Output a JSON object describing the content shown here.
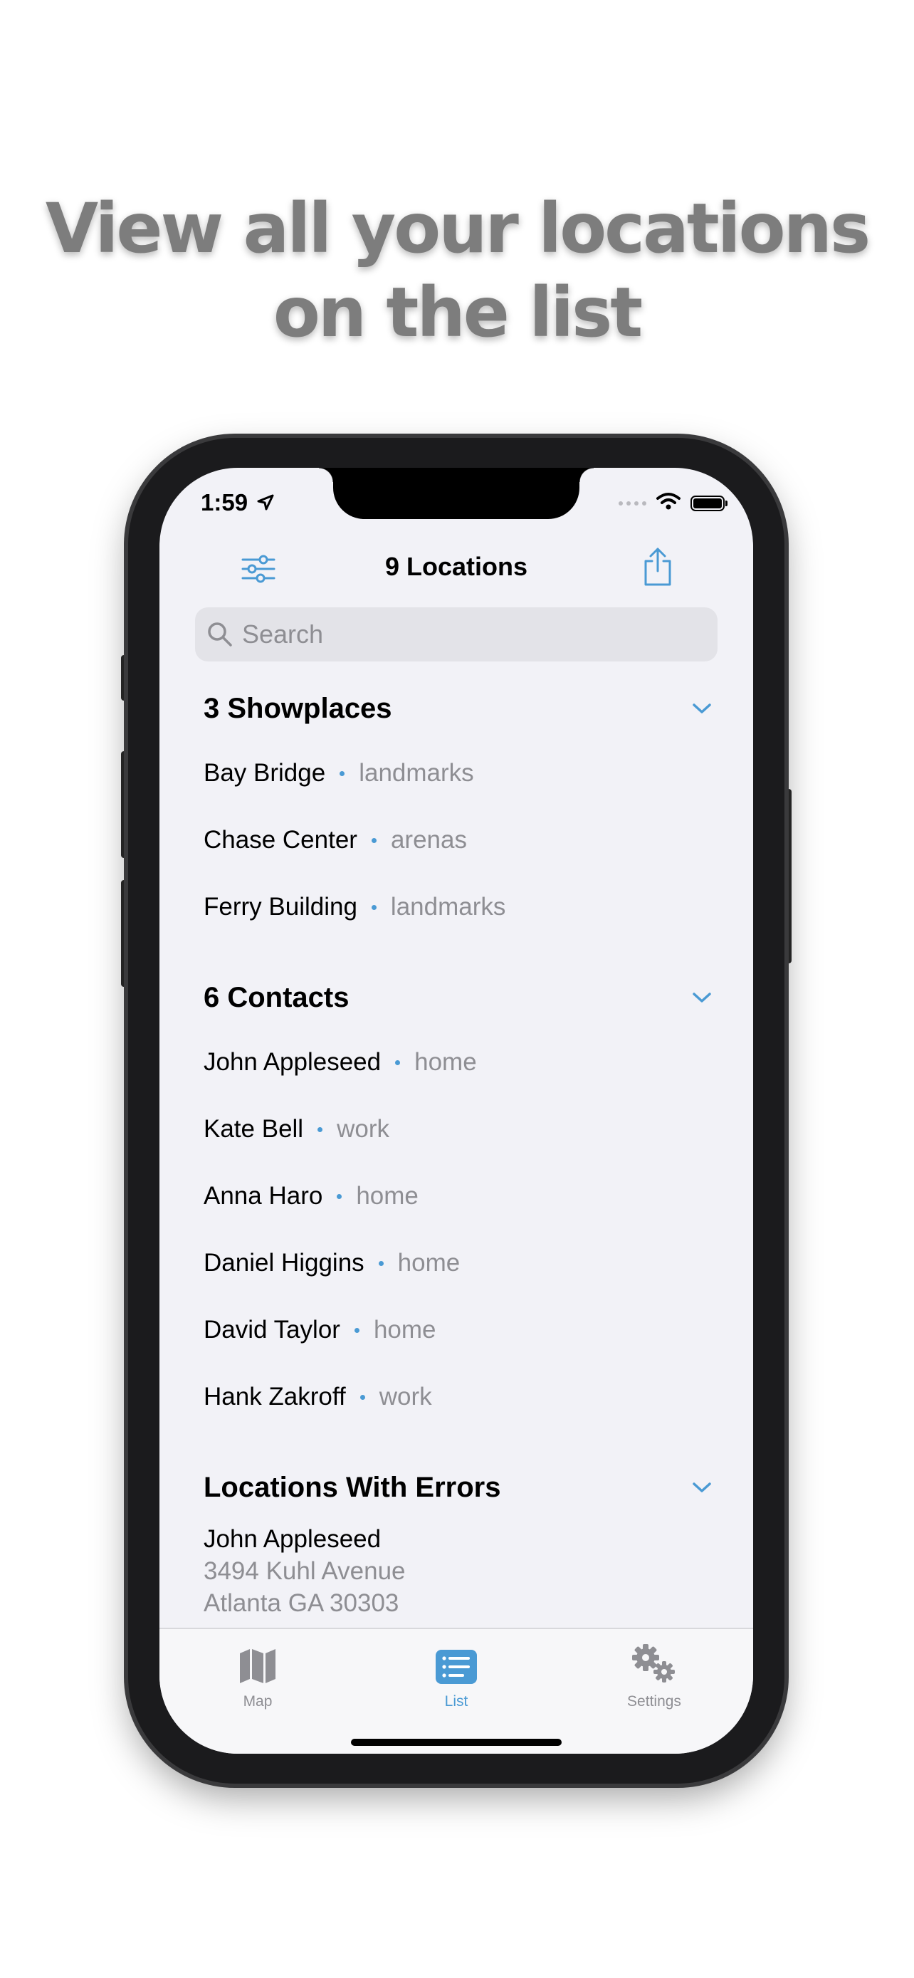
{
  "promo": {
    "headline_line1": "View all your locations",
    "headline_line2": "on the list"
  },
  "status_bar": {
    "time": "1:59"
  },
  "nav": {
    "title": "9 Locations"
  },
  "search": {
    "placeholder": "Search",
    "value": ""
  },
  "sections": {
    "showplaces": {
      "title": "3 Showplaces",
      "items": [
        {
          "name": "Bay Bridge",
          "tag": "landmarks"
        },
        {
          "name": "Chase Center",
          "tag": "arenas"
        },
        {
          "name": "Ferry Building",
          "tag": "landmarks"
        }
      ]
    },
    "contacts": {
      "title": "6 Contacts",
      "items": [
        {
          "name": "John Appleseed",
          "tag": "home"
        },
        {
          "name": "Kate Bell",
          "tag": "work"
        },
        {
          "name": "Anna Haro",
          "tag": "home"
        },
        {
          "name": "Daniel Higgins",
          "tag": "home"
        },
        {
          "name": "David Taylor",
          "tag": "home"
        },
        {
          "name": "Hank Zakroff",
          "tag": "work"
        }
      ]
    },
    "errors": {
      "title": "Locations With Errors",
      "items": [
        {
          "name": "John Appleseed",
          "line1": "3494 Kuhl Avenue",
          "line2": "Atlanta GA 30303"
        }
      ]
    }
  },
  "tabbar": {
    "tabs": [
      {
        "label": "Map",
        "icon": "map-icon",
        "selected": false
      },
      {
        "label": "List",
        "icon": "list-icon",
        "selected": true
      },
      {
        "label": "Settings",
        "icon": "gears-icon",
        "selected": false
      }
    ]
  },
  "colors": {
    "accent": "#4a9ad4",
    "headline": "#7d7d7d",
    "secondary_text": "#8e8e93",
    "screen_background": "#f2f2f7"
  }
}
